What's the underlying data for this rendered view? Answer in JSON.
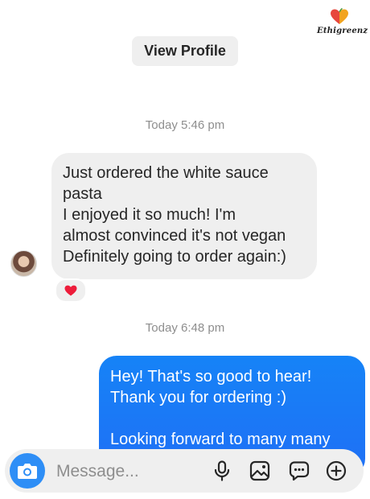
{
  "brand": {
    "logo_text": "Ethigreenz"
  },
  "header": {
    "view_profile_label": "View Profile"
  },
  "thread": {
    "timestamp_1": "Today 5:46 pm",
    "incoming_message_lines": [
      "Just ordered the white sauce",
      "pasta",
      "I enjoyed it so much! I'm",
      "almost convinced it's not vegan",
      "Definitely going to order again:)"
    ],
    "reaction_emoji": "❤️",
    "timestamp_2": "Today 6:48 pm",
    "outgoing_message_lines": [
      "Hey! That's so good to hear!",
      "Thank you for ordering :)",
      "",
      "Looking forward to many many"
    ]
  },
  "composer": {
    "placeholder": "Message...",
    "icons": [
      "camera-icon",
      "microphone-icon",
      "gallery-icon",
      "sticker-icon",
      "plus-icon"
    ]
  },
  "colors": {
    "outgoing_bubble": "#1f78f6",
    "incoming_bubble": "#efefef",
    "camera_button": "#2e8ef6",
    "heart": "#ed1c3a"
  }
}
